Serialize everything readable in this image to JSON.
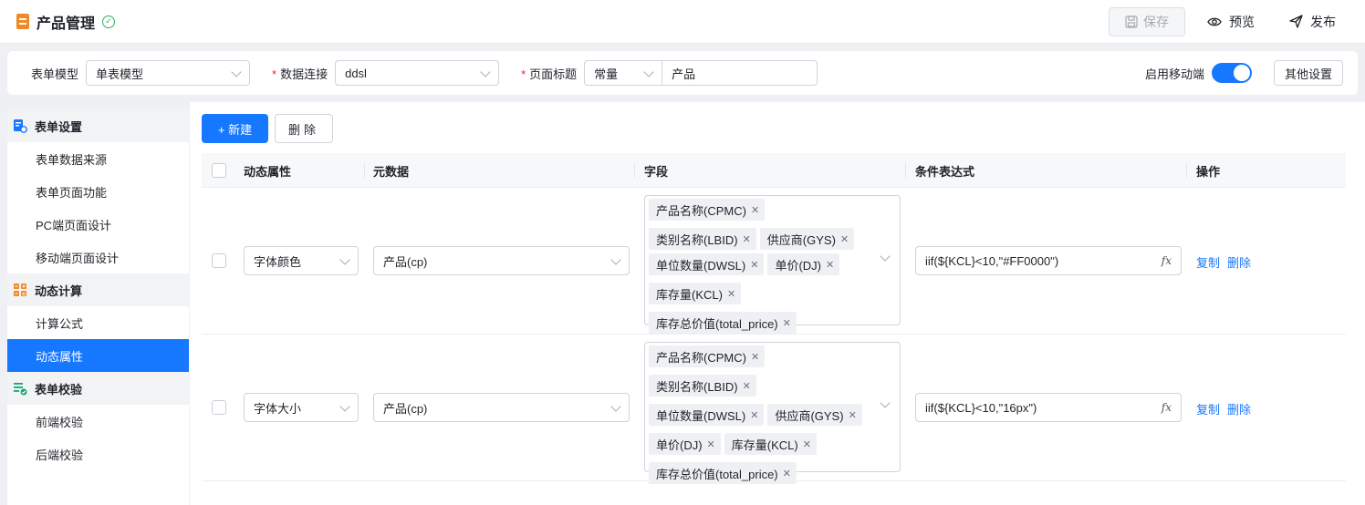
{
  "header": {
    "title": "产品管理",
    "save_label": "保存",
    "preview_label": "预览",
    "publish_label": "发布"
  },
  "config": {
    "form_model_label": "表单模型",
    "form_model_value": "单表模型",
    "data_conn_label": "数据连接",
    "data_conn_value": "ddsl",
    "page_title_label": "页面标题",
    "page_title_type": "常量",
    "page_title_value": "产品",
    "mobile_label": "启用移动端",
    "mobile_enabled": true,
    "other_settings_label": "其他设置"
  },
  "sidebar": {
    "groups": [
      {
        "label": "表单设置",
        "items": [
          "表单数据来源",
          "表单页面功能",
          "PC端页面设计",
          "移动端页面设计"
        ]
      },
      {
        "label": "动态计算",
        "items": [
          "计算公式",
          "动态属性"
        ]
      },
      {
        "label": "表单校验",
        "items": [
          "前端校验",
          "后端校验"
        ]
      }
    ],
    "active_item": "动态属性"
  },
  "toolbar": {
    "new_label": "+ 新建",
    "delete_label": "删除"
  },
  "table": {
    "headers": [
      "动态属性",
      "元数据",
      "字段",
      "条件表达式",
      "操作"
    ],
    "rows": [
      {
        "attribute": "字体颜色",
        "metadata": "产品(cp)",
        "fields": [
          "产品名称(CPMC)",
          "类别名称(LBID)",
          "供应商(GYS)",
          "单位数量(DWSL)",
          "单价(DJ)",
          "库存量(KCL)",
          "库存总价值(total_price)"
        ],
        "expression": "iif(${KCL}<10,\"#FF0000\")",
        "actions": [
          "复制",
          "删除"
        ]
      },
      {
        "attribute": "字体大小",
        "metadata": "产品(cp)",
        "fields": [
          "产品名称(CPMC)",
          "类别名称(LBID)",
          "单位数量(DWSL)",
          "供应商(GYS)",
          "单价(DJ)",
          "库存量(KCL)",
          "库存总价值(total_price)"
        ],
        "expression": "iif(${KCL}<10,\"16px\")",
        "actions": [
          "复制",
          "删除"
        ]
      }
    ]
  },
  "colors": {
    "primary": "#1677ff",
    "required": "#f5222d",
    "success": "#27b25a",
    "title_icon": "#f08a24"
  }
}
